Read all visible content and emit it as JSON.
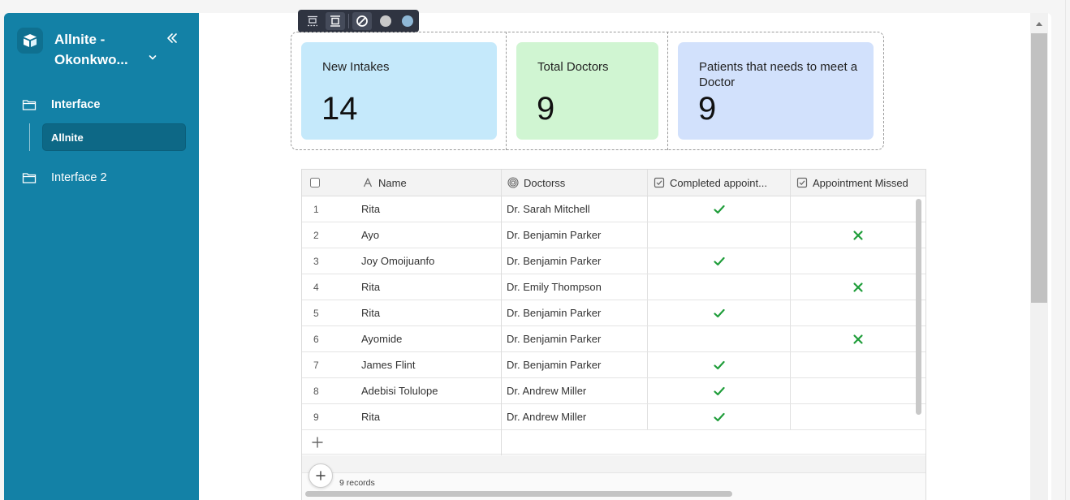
{
  "sidebar": {
    "workspace_title": "Allnite - Okonkwo...",
    "nav": [
      {
        "label": "Interface",
        "children": [
          {
            "label": "Allnite"
          }
        ]
      },
      {
        "label": "Interface 2"
      }
    ]
  },
  "stats": [
    {
      "label": "New Intakes",
      "value": "14",
      "color": "#c5e9fb"
    },
    {
      "label": "Total Doctors",
      "value": "9",
      "color": "#d0f5d2"
    },
    {
      "label": "Patients that needs to meet a Doctor",
      "value": "9",
      "color": "#d2e1fc"
    }
  ],
  "colors": {
    "sidebar_bg": "#1381a6",
    "sidebar_active": "#0d6886",
    "check_green": "#1f9d3a",
    "toolbar_bg": "#2f3441"
  },
  "grid": {
    "columns": [
      {
        "label": "Name",
        "icon": "text-field-icon"
      },
      {
        "label": "Doctorss",
        "icon": "link-field-icon"
      },
      {
        "label": "Completed appoint...",
        "icon": "checkbox-field-icon"
      },
      {
        "label": "Appointment Missed",
        "icon": "checkbox-field-icon"
      }
    ],
    "rows": [
      {
        "index": "1",
        "name": "Rita",
        "doctor": "Dr. Sarah Mitchell",
        "completed": true,
        "missed": false
      },
      {
        "index": "2",
        "name": "Ayo",
        "doctor": "Dr. Benjamin Parker",
        "completed": false,
        "missed": true
      },
      {
        "index": "3",
        "name": "Joy Omoijuanfo",
        "doctor": "Dr. Benjamin Parker",
        "completed": true,
        "missed": false
      },
      {
        "index": "4",
        "name": "Rita",
        "doctor": "Dr. Emily Thompson",
        "completed": false,
        "missed": true
      },
      {
        "index": "5",
        "name": "Rita",
        "doctor": "Dr. Benjamin Parker",
        "completed": true,
        "missed": false
      },
      {
        "index": "6",
        "name": "Ayomide",
        "doctor": "Dr. Benjamin Parker",
        "completed": false,
        "missed": true
      },
      {
        "index": "7",
        "name": "James Flint",
        "doctor": "Dr. Benjamin Parker",
        "completed": true,
        "missed": false
      },
      {
        "index": "8",
        "name": "Adebisi Tolulope",
        "doctor": "Dr. Andrew Miller",
        "completed": true,
        "missed": false
      },
      {
        "index": "9",
        "name": "Rita",
        "doctor": "Dr. Andrew Miller",
        "completed": true,
        "missed": false
      }
    ],
    "record_count": "9 records"
  },
  "toolbar": {
    "dot_colors": [
      "#c8c8c8",
      "#8fb8d6"
    ]
  }
}
